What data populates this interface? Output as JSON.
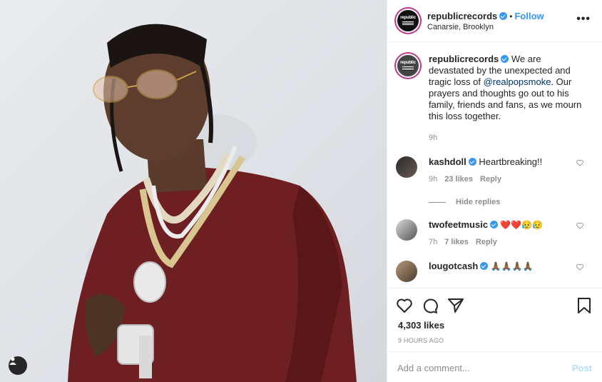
{
  "post": {
    "username": "republicrecords",
    "follow_label": "Follow",
    "dot": "•",
    "location": "Canarsie, Brooklyn",
    "more_label": "•••",
    "avatar_text": "republic"
  },
  "caption": {
    "username": "republicrecords",
    "text_before": " We are devastated by the unexpected and tragic loss of ",
    "mention": "@realpopsmoke",
    "text_after": ". Our prayers and thoughts go out to his family, friends and fans, as we mourn this loss together.",
    "time": "9h"
  },
  "comments": [
    {
      "username": "kashdoll",
      "text": " Heartbreaking!!",
      "time": "9h",
      "likes": "23 likes",
      "reply": "Reply"
    },
    {
      "username": "twofeetmusic",
      "text": " ❤️❤️😥😥",
      "time": "7h",
      "likes": "7 likes",
      "reply": "Reply"
    },
    {
      "username": "lougotcash",
      "text": " 🙏🏾🙏🏾🙏🏾🙏🏾"
    }
  ],
  "hide_replies": "Hide replies",
  "likes_count": "4,303 likes",
  "time_ago": "9 HOURS AGO",
  "add_comment": {
    "placeholder": "Add a comment...",
    "post_label": "Post"
  },
  "icons": [
    "heart-icon",
    "comment-icon",
    "share-icon",
    "bookmark-icon",
    "tag-user-icon"
  ],
  "colors": {
    "accent": "#3897f0",
    "text": "#262626",
    "muted": "#8e8e8e",
    "sweater": "#6e1f22"
  }
}
